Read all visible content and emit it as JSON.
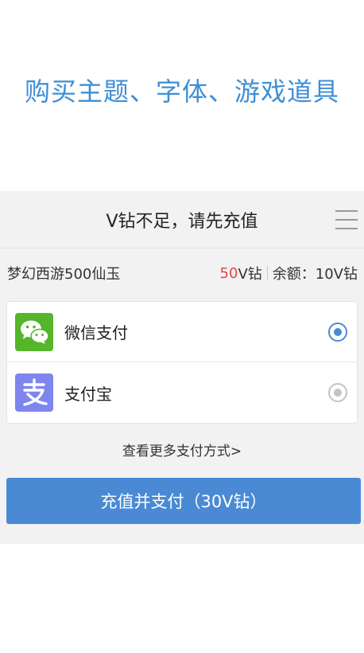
{
  "headline": "购买主题、字体、游戏道具",
  "sheet": {
    "title": "V钻不足，请先充值"
  },
  "product": {
    "name": "梦幻西游500仙玉",
    "price_value": "50",
    "price_unit": "V钻",
    "balance_text": "余额：10V钻"
  },
  "payment_methods": [
    {
      "name": "微信支付",
      "icon": "wechat-icon",
      "selected": true,
      "color": "#55b52b"
    },
    {
      "name": "支付宝",
      "icon": "alipay-icon",
      "selected": false,
      "color": "#7f85ef"
    }
  ],
  "more_link": "查看更多支付方式>",
  "pay_button": "充值并支付（30V钻）",
  "colors": {
    "accent": "#4a8ad4",
    "headline": "#3e8ed6",
    "price": "#e24a3f"
  }
}
